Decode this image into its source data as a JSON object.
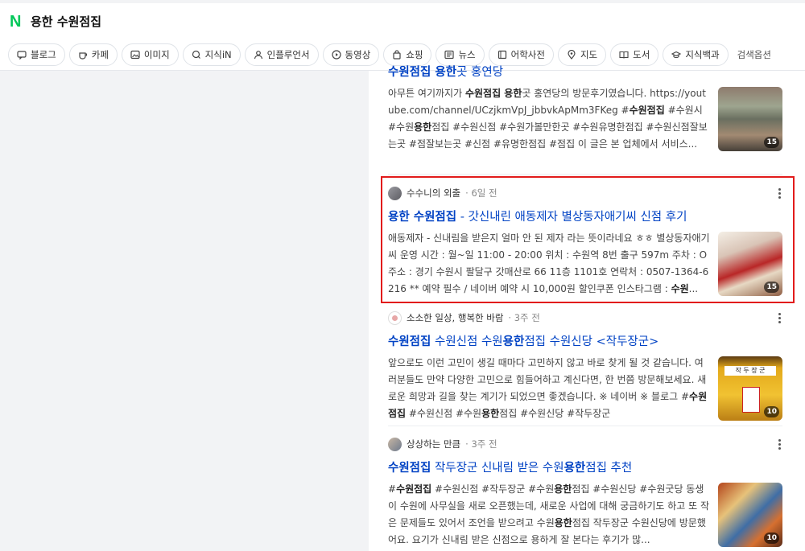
{
  "header": {
    "query": "용한 수원점집",
    "tabs": [
      {
        "label": "블로그",
        "icon": "blog-icon"
      },
      {
        "label": "카페",
        "icon": "cafe-icon"
      },
      {
        "label": "이미지",
        "icon": "image-icon"
      },
      {
        "label": "지식iN",
        "icon": "knowledge-icon"
      },
      {
        "label": "인플루언서",
        "icon": "influencer-icon"
      },
      {
        "label": "동영상",
        "icon": "video-icon"
      },
      {
        "label": "쇼핑",
        "icon": "shopping-icon"
      },
      {
        "label": "뉴스",
        "icon": "news-icon"
      },
      {
        "label": "어학사전",
        "icon": "dictionary-icon"
      },
      {
        "label": "지도",
        "icon": "map-icon"
      },
      {
        "label": "도서",
        "icon": "book-icon"
      },
      {
        "label": "지식백과",
        "icon": "encyclopedia-icon"
      }
    ],
    "search_options": "검색옵션"
  },
  "results": [
    {
      "title_pre": "",
      "title_bold": "수원점집 용한",
      "title_post": "곳 홍연당",
      "snippet_html": "아무튼 여기까지가 <b>수원점집 용한</b>곳 홍연당의 방문후기였습니다. https://youtube.com/channel/UCzjkmVpJ_jbbvkApMm3FKeg #<b>수원점집</b> #수원시 #수원<b>용한</b>점집 #수원신점 #수원가볼만한곳 #수원유명한점집 #수원신점잘보는곳 #점잘보는곳 #신점 #유명한점집 #점집 이 글은 본 업체에서 서비스...",
      "count": "15"
    },
    {
      "author": "수수니의 외출",
      "time": "6일 전",
      "title_bold": "용한 수원점집",
      "title_post": " - 갓신내린 애동제자 별상동자애기씨 신점 후기",
      "snippet_html": "애동제자 - 신내림을 받은지 얼마 안 된 제자 라는 뜻이라네요 ㅎㅎ 별상동자애기씨 운영 시간 : 월~일 11:00 - 20:00 위치 : 수원역 8번 출구 597m 주차 : O 주소 : 경기 수원시 팔달구 갓매산로 66 11층 1101호 연락처 : 0507-1364-6216 ** 예약 필수 / 네이버 예약 시 10,000원 할인쿠폰 인스타그램 : <b>수원</b>...",
      "count": "15"
    },
    {
      "author": "소소한 일상, 행복한 바람",
      "time": "3주 전",
      "title_html": "<b>수원점집</b> 수원신점 수원<b>용한</b>점집 수원신당 &lt;작두장군&gt;",
      "snippet_html": "앞으로도 이런 고민이 생길 때마다 고민하지 않고 바로 찾게 될 것 같습니다. 여러분들도 만약 다양한 고민으로 힘들어하고 계신다면, 한 번쯤 방문해보세요. 새로운 희망과 길을 찾는 계기가 되었으면 좋겠습니다. ※ 네이버 ※ 블로그 #<b>수원점집</b> #수원신점 #수원<b>용한</b>점집 #수원신당 #작두장군",
      "thumb_sign": "작 두 장 군",
      "count": "10"
    },
    {
      "author": "상상하는 만큼",
      "time": "3주 전",
      "title_html": "<b>수원점집</b> 작두장군 신내림 받은 수원<b>용한</b>점집 추천",
      "snippet_html": "#<b>수원점집</b> #수원신점 #작두장군 #수원<b>용한</b>점집 #수원신당 #수원굿당 동생이 수원에 사무실을 새로 오픈했는데, 새로운 사업에 대해 궁금하기도 하고 또 작은 문제들도 있어서 조언을 받으려고 수원<b>용한</b>점집 작두장군 수원신당에 방문했어요. 요기가 신내림 받은 신점으로 용하게 잘 본다는 후기가 많...",
      "count": "10"
    }
  ],
  "colors": {
    "title_link": "#0042c4",
    "naver_green": "#03c75a",
    "highlight_border": "#e21b1b"
  }
}
